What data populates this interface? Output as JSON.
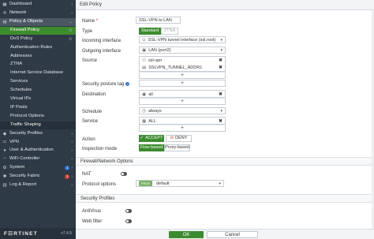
{
  "sidebar": {
    "items": [
      {
        "label": "Dashboard",
        "icon": "dashboard-icon",
        "glyph": "▦",
        "level": "top",
        "state": "",
        "chev": "›"
      },
      {
        "label": "Network",
        "icon": "network-icon",
        "glyph": "✢",
        "level": "top",
        "state": "",
        "chev": "›"
      },
      {
        "label": "Policy & Objects",
        "icon": "policy-icon",
        "glyph": "▤",
        "level": "top",
        "state": "highlight",
        "chev": "⌄"
      },
      {
        "label": "Firewall Policy",
        "level": "sub",
        "state": "active",
        "star": "☆"
      },
      {
        "label": "DoS Policy",
        "level": "sub",
        "state": "",
        "star": "☆"
      },
      {
        "label": "Authentication Rules",
        "level": "sub",
        "state": ""
      },
      {
        "label": "Addresses",
        "level": "sub",
        "state": ""
      },
      {
        "label": "ZTNA",
        "level": "sub",
        "state": ""
      },
      {
        "label": "Internet Service Database",
        "level": "sub",
        "state": ""
      },
      {
        "label": "Services",
        "level": "sub",
        "state": ""
      },
      {
        "label": "Schedules",
        "level": "sub",
        "state": ""
      },
      {
        "label": "Virtual IPs",
        "level": "sub",
        "state": ""
      },
      {
        "label": "IP Pools",
        "level": "sub",
        "state": ""
      },
      {
        "label": "Protocol Options",
        "level": "sub",
        "state": ""
      },
      {
        "label": "Traffic Shaping",
        "level": "sub",
        "state": "subactive"
      },
      {
        "label": "Security Profiles",
        "icon": "security-profiles-icon",
        "glyph": "◆",
        "level": "top",
        "state": "",
        "chev": "›"
      },
      {
        "label": "VPN",
        "icon": "vpn-icon",
        "glyph": "▭",
        "level": "top",
        "state": "",
        "chev": "›"
      },
      {
        "label": "User & Authentication",
        "icon": "user-icon",
        "glyph": "●",
        "level": "top",
        "state": "",
        "chev": "›"
      },
      {
        "label": "WiFi Controller",
        "icon": "wifi-icon",
        "glyph": "◠",
        "level": "top",
        "state": "",
        "chev": "›"
      },
      {
        "label": "System",
        "icon": "system-icon",
        "glyph": "⚙",
        "level": "top",
        "state": "",
        "badge": "1",
        "badge_color": "blue",
        "chev": "›"
      },
      {
        "label": "Security Fabric",
        "icon": "security-fabric-icon",
        "glyph": "✱",
        "level": "top",
        "state": "",
        "badge": "1",
        "badge_color": "red",
        "chev": "›"
      },
      {
        "label": "Log & Report",
        "icon": "log-report-icon",
        "glyph": "▥",
        "level": "top",
        "state": "",
        "chev": "›"
      }
    ],
    "logo": "F☷RTINET",
    "version": "v7.4.5"
  },
  "header": {
    "title": "Edit Policy"
  },
  "form": {
    "name_label": "Name",
    "name_value": "SSL-VPN to LAN",
    "type_label": "Type",
    "type_options": [
      "Standard",
      "ZTNA"
    ],
    "incoming_label": "Incoming interface",
    "incoming_value": "SSL-VPN tunnel interface (ssl.root)",
    "outgoing_label": "Outgoing interface",
    "outgoing_value": "LAN (port2)",
    "source_label": "Source",
    "source_items": [
      "ssl-vpn",
      "SSLVPN_TUNNEL_ADDR1"
    ],
    "posture_label": "Security posture tag",
    "destination_label": "Destination",
    "destination_items": [
      "all"
    ],
    "schedule_label": "Schedule",
    "schedule_value": "always",
    "service_label": "Service",
    "service_items": [
      "ALL"
    ],
    "action_label": "Action",
    "action_accept": "ACCEPT",
    "action_deny": "DENY",
    "inspection_label": "Inspection mode",
    "inspection_options": [
      "Flow-based",
      "Proxy-based"
    ],
    "plus": "+",
    "remove": "✖",
    "caret": "▾",
    "required_mark": "*",
    "info_mark": "i"
  },
  "sections": {
    "firewall_network": "Firewall/Network Options",
    "nat_label": "NAT",
    "protocol_label": "Protocol options",
    "protocol_tag": "PROF",
    "protocol_value": "default",
    "security_profiles": "Security Profiles",
    "antivirus_label": "AntiVirus",
    "webfilter_label": "Web filter"
  },
  "footer": {
    "ok": "OK",
    "cancel": "Cancel"
  },
  "colors": {
    "accent": "#3d8b2f",
    "sidebar": "#2e3a46",
    "badge_blue": "#2b6fd1",
    "badge_red": "#d03a2f"
  }
}
